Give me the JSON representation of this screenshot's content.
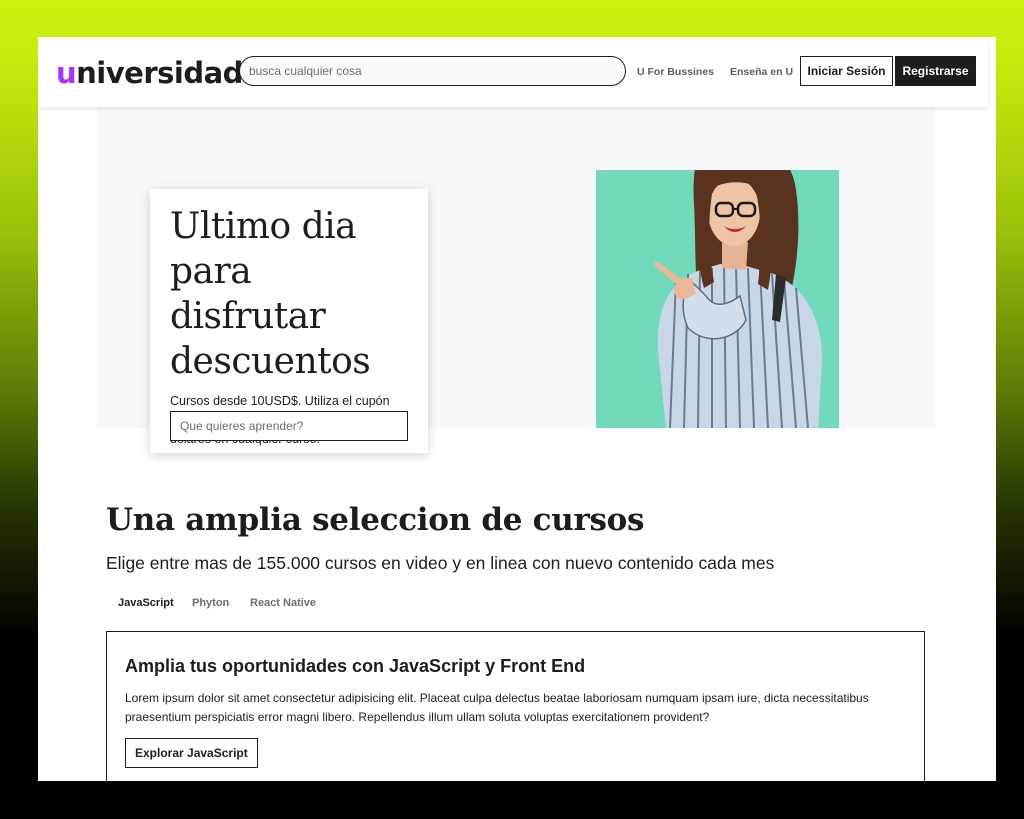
{
  "header": {
    "logo_first_letter": "u",
    "logo_rest": "niversidad",
    "search_placeholder": "busca cualquier cosa",
    "nav_business": "U For Bussines",
    "nav_teach": "Enseña en U",
    "login_label": "Iniciar Sesión",
    "register_label": "Registrarse"
  },
  "hero": {
    "title": "Ultimo dia para disfrutar descuentos",
    "text": "Cursos desde 10USD$. Utiliza el cupón 10USD$ para pagar unicamente 10 dolares en cualquier curso.",
    "input_placeholder": "Que quieres aprender?",
    "photo_background": "#72d9bd"
  },
  "courses": {
    "title": "Una amplia seleccion de cursos",
    "subtitle": "Elige entre mas de 155.000 cursos en video y en linea con nuevo contenido cada mes",
    "tabs": [
      {
        "label": "JavaScript",
        "active": true
      },
      {
        "label": "Phyton",
        "active": false
      },
      {
        "label": "React Native",
        "active": false
      }
    ],
    "card": {
      "heading": "Amplia tus oportunidades con JavaScript y Front End",
      "description": "Lorem ipsum dolor sit amet consectetur adipisicing elit. Placeat culpa delectus beatae laboriosam numquam ipsam iure, dicta necessitatibus praesentium perspiciatis error magni libero. Repellendus illum ullam soluta voluptas exercitationem provident?",
      "button_label": "Explorar JavaScript"
    }
  },
  "colors": {
    "accent": "#a435f0",
    "dark": "#1c1d1f",
    "hero_bg": "#f7f8fa",
    "frame_gradient_top": "#cdf20f"
  }
}
